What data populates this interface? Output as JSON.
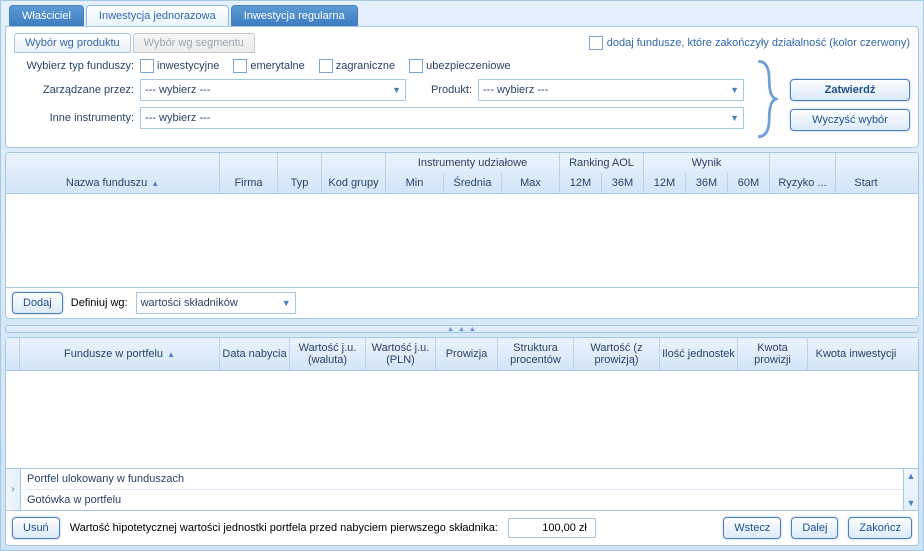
{
  "tabs": {
    "owner": "Właściciel",
    "oneTime": "Inwestycja jednorazowa",
    "regular": "Inwestycja regularna"
  },
  "subTabs": {
    "byProduct": "Wybór wg produktu",
    "bySegment": "Wybór wg segmentu"
  },
  "addClosed": "dodaj fundusze, które zakończyły działalność (kolor czerwony)",
  "labels": {
    "fundType": "Wybierz typ funduszy:",
    "managedBy": "Zarządzane przez:",
    "product": "Produkt:",
    "otherInstruments": "Inne instrumenty:",
    "definiujWg": "Definiuj wg:",
    "hypothetical": "Wartość hipotetycznej wartości jednostki portfela przed nabyciem pierwszego składnika:"
  },
  "checks": {
    "inwestycyjne": "inwestycyjne",
    "emerytalne": "emerytalne",
    "zagraniczne": "zagraniczne",
    "ubezpieczeniowe": "ubezpieczeniowe"
  },
  "selects": {
    "placeholder": "--- wybierz ---",
    "definiujValue": "wartości składników"
  },
  "buttons": {
    "zatwierdz": "Zatwierdź",
    "wyczysc": "Wyczyść wybór",
    "dodaj": "Dodaj",
    "usun": "Usuń",
    "wstecz": "Wstecz",
    "dalej": "Dalej",
    "zakoncz": "Zakończ"
  },
  "grid1": {
    "groupInstr": "Instrumenty udziałowe",
    "groupRank": "Ranking AOL",
    "groupWynik": "Wynik",
    "nazwa": "Nazwa funduszu",
    "firma": "Firma",
    "typ": "Typ",
    "kodGrupy": "Kod grupy",
    "min": "Min",
    "srednia": "Średnia",
    "max": "Max",
    "r12m": "12M",
    "r36m": "36M",
    "w12m": "12M",
    "w36m": "36M",
    "w60m": "60M",
    "ryzyko": "Ryzyko ...",
    "start": "Start"
  },
  "grid2": {
    "fundusze": "Fundusze w portfelu",
    "dataNabycia": "Data nabycia",
    "wartWaluta": "Wartość j.u.(waluta)",
    "wartPln": "Wartość j.u.(PLN)",
    "prowizja": "Prowizja",
    "struktura": "Struktura procentów",
    "wartProw": "Wartość (z prowizją)",
    "ilosc": "Ilość jednostek",
    "kwotaProw": "Kwota prowizji",
    "kwotaInw": "Kwota inwestycji"
  },
  "summary": {
    "portfel": "Portfel ulokowany w funduszach",
    "gotowka": "Gotówka w portfelu"
  },
  "hypotheticalValue": "100,00 zł"
}
